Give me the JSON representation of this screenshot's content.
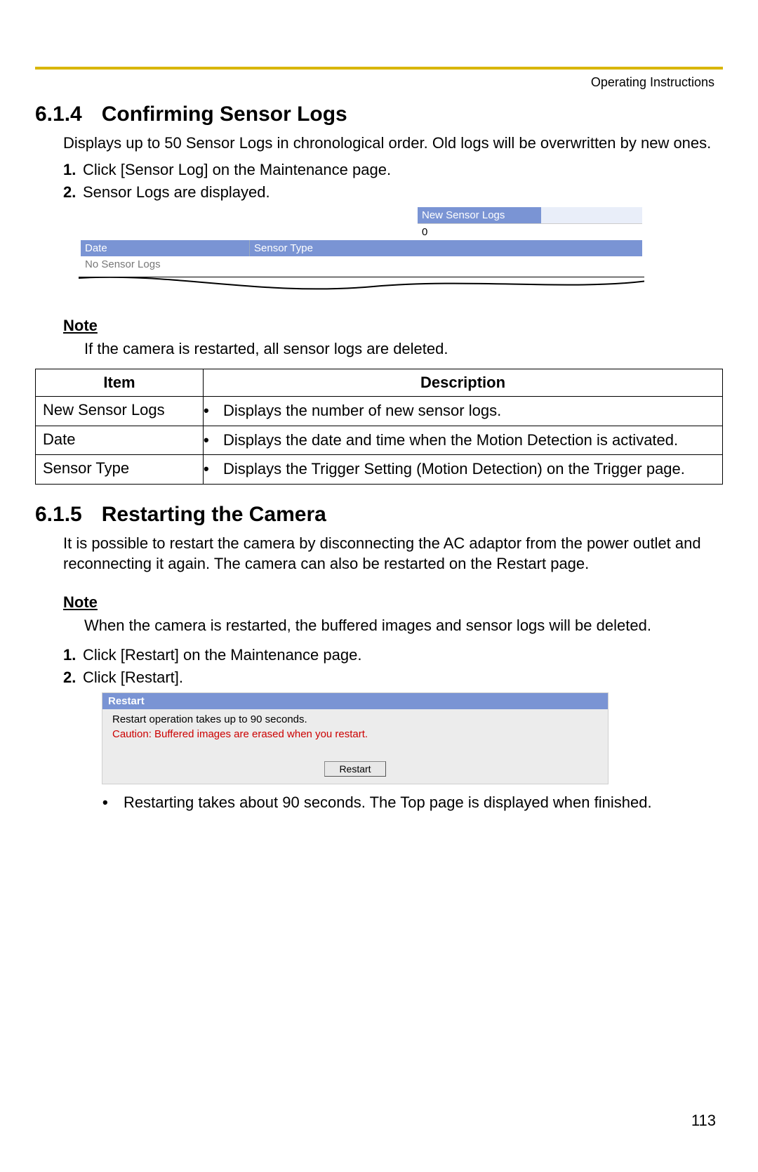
{
  "header": {
    "doc_type": "Operating Instructions"
  },
  "sec_614": {
    "number": "6.1.4",
    "title": "Confirming Sensor Logs",
    "intro": "Displays up to 50 Sensor Logs in chronological order. Old logs will be overwritten by new ones.",
    "steps": [
      "Click [Sensor Log] on the Maintenance page.",
      "Sensor Logs are displayed."
    ],
    "note_title": "Note",
    "note_body": "If the camera is restarted, all sensor logs are deleted."
  },
  "sensor_shot": {
    "label_new": "New Sensor Logs",
    "value_new": "0",
    "col_date": "Date",
    "col_type": "Sensor Type",
    "empty_msg": "No Sensor Logs"
  },
  "desc_table": {
    "head_item": "Item",
    "head_desc": "Description",
    "rows": [
      {
        "item": "New Sensor Logs",
        "desc": "Displays the number of new sensor logs."
      },
      {
        "item": "Date",
        "desc": "Displays the date and time when the Motion Detection is activated."
      },
      {
        "item": "Sensor Type",
        "desc": "Displays the Trigger Setting (Motion Detection) on the Trigger page."
      }
    ]
  },
  "sec_615": {
    "number": "6.1.5",
    "title": "Restarting the Camera",
    "intro": "It is possible to restart the camera by disconnecting the AC adaptor from the power outlet and reconnecting it again. The camera can also be restarted on the Restart page.",
    "note_title": "Note",
    "note_body": "When the camera is restarted, the buffered images and sensor logs will be deleted.",
    "steps": [
      "Click [Restart] on the Maintenance page.",
      "Click [Restart]."
    ],
    "after_bullet": "Restarting takes about 90 seconds. The Top page is displayed when finished."
  },
  "restart_shot": {
    "title": "Restart",
    "msg": "Restart operation takes up to 90 seconds.",
    "warn": "Caution: Buffered images are erased when you restart.",
    "button": "Restart"
  },
  "page_number": "113"
}
